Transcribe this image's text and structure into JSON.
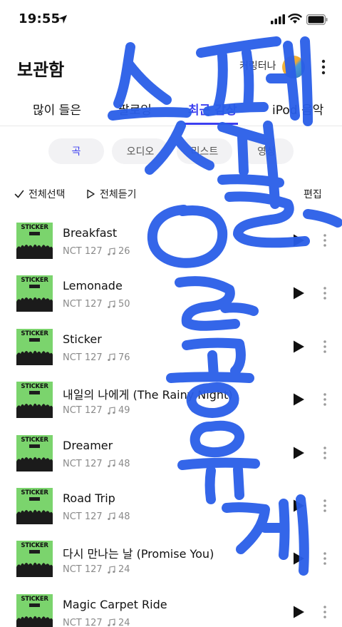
{
  "status_bar": {
    "time": "19:55"
  },
  "header": {
    "title": "보관함",
    "user_name": "커링터나"
  },
  "tabs": [
    {
      "label": "많이 들은"
    },
    {
      "label": "팔로잉"
    },
    {
      "label": "최근 감상"
    },
    {
      "label": "iPod 음악"
    }
  ],
  "filters": [
    {
      "label": "곡"
    },
    {
      "label": "오디오"
    },
    {
      "label": "리스트"
    },
    {
      "label": "영상"
    }
  ],
  "actions": {
    "select_all": "전체선택",
    "play_all": "전체듣기",
    "edit": "편집"
  },
  "songs": [
    {
      "title": "Breakfast",
      "artist": "NCT 127",
      "plays": "26"
    },
    {
      "title": "Lemonade",
      "artist": "NCT 127",
      "plays": "50"
    },
    {
      "title": "Sticker",
      "artist": "NCT 127",
      "plays": "76"
    },
    {
      "title": "내일의 나에게 (The Rainy Night)",
      "artist": "NCT 127",
      "plays": "49"
    },
    {
      "title": "Dreamer",
      "artist": "NCT 127",
      "plays": "48"
    },
    {
      "title": "Road Trip",
      "artist": "NCT 127",
      "plays": "48"
    },
    {
      "title": "다시 만나는 날 (Promise You)",
      "artist": "NCT 127",
      "plays": "24"
    },
    {
      "title": "Magic Carpet Ride",
      "artist": "NCT 127",
      "plays": "24"
    }
  ],
  "album_art_text": "STICKER",
  "colors": {
    "accent": "#3c3ff0",
    "scribble": "#2a5ee8",
    "album_green": "#7bd46d"
  }
}
